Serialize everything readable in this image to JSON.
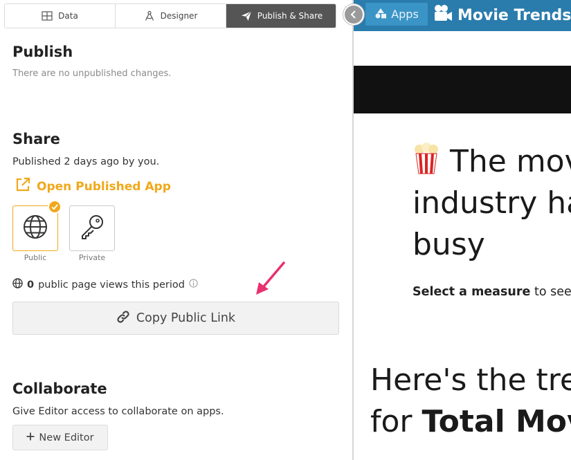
{
  "tabs": [
    {
      "label": "Data",
      "icon": "table-icon"
    },
    {
      "label": "Designer",
      "icon": "compass-icon"
    },
    {
      "label": "Publish & Share",
      "icon": "paper-plane-icon",
      "active": true
    }
  ],
  "publish": {
    "title": "Publish",
    "status": "There are no unpublished changes."
  },
  "share": {
    "title": "Share",
    "status": "Published 2 days ago by you.",
    "open_app_label": "Open Published App",
    "visibility": [
      {
        "label": "Public",
        "icon": "globe-icon",
        "selected": true
      },
      {
        "label": "Private",
        "icon": "key-icon",
        "selected": false
      }
    ],
    "views_count": "0",
    "views_text": "public page views this period",
    "copy_link_label": "Copy Public Link"
  },
  "collaborate": {
    "title": "Collaborate",
    "description": "Give Editor access to collaborate on apps.",
    "new_editor_label": "New Editor"
  },
  "preview": {
    "apps_label": "Apps",
    "app_title": "Movie Trends",
    "hero_emoji": "🍿",
    "hero_lines": [
      "The mov",
      "industry ha",
      "busy"
    ],
    "select_bold": "Select a measure",
    "select_rest": "to see th",
    "trend_line1": "Here's the tre",
    "trend_line2_prefix": "for",
    "trend_line2_bold": "Total Mov"
  },
  "colors": {
    "accent": "#f0a81a",
    "active_tab": "#555555",
    "header_blue": "#2a7cad",
    "apps_button": "#3b94c6",
    "arrow": "#e8316e"
  }
}
